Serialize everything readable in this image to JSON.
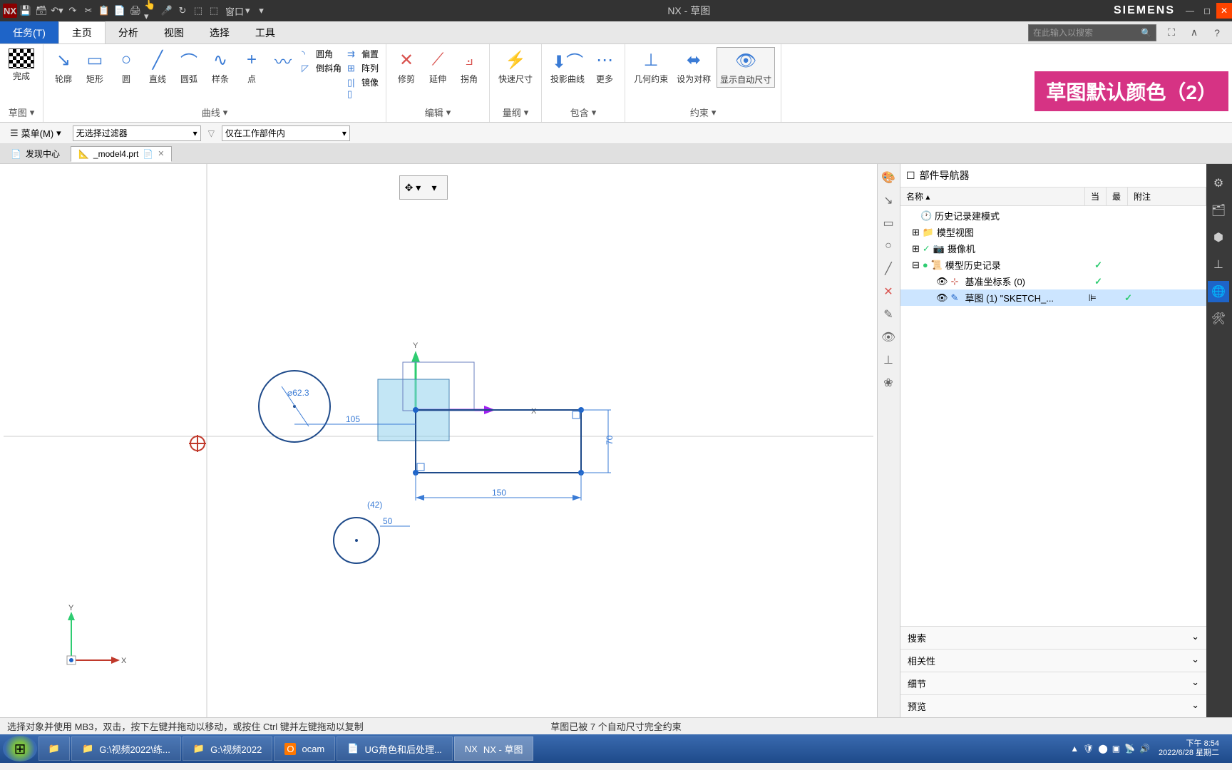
{
  "titlebar": {
    "app_title": "NX - 草图",
    "brand": "SIEMENS",
    "window_menu": "窗口"
  },
  "tabs": {
    "task": "任务(T)",
    "home": "主页",
    "analysis": "分析",
    "view": "视图",
    "select": "选择",
    "tools": "工具"
  },
  "search": {
    "placeholder": "在此输入以搜索"
  },
  "ribbon": {
    "finish": "完成",
    "sketch_group": "草图",
    "profile": "轮廓",
    "rect": "矩形",
    "circle": "圆",
    "line": "直线",
    "arc": "圆弧",
    "spline": "样条",
    "point": "点",
    "fillet": "圆角",
    "chamfer": "倒斜角",
    "offset": "偏置",
    "pattern": "阵列",
    "mirror": "镜像",
    "curve_group": "曲线",
    "trim": "修剪",
    "extend": "延伸",
    "corner": "拐角",
    "edit_group": "编辑",
    "quick_dim": "快速尺寸",
    "dim_group": "量纲",
    "project": "投影曲线",
    "more": "更多",
    "include_group": "包含",
    "geo_constraint": "几何约束",
    "symmetric": "设为对称",
    "show_auto_dim": "显示自动尺寸",
    "constraint_group": "约束"
  },
  "pink_banner": "草图默认颜色（2）",
  "filter": {
    "menu": "菜单(M)",
    "no_filter": "无选择过滤器",
    "workpart": "仅在工作部件内"
  },
  "doctabs": {
    "discover": "发现中心",
    "model": "_model4.prt"
  },
  "sketch_dims": {
    "dia": "62.3",
    "dim105": "105",
    "dim150": "150",
    "dim70": "70",
    "dim50": "50",
    "angle": "(42)"
  },
  "navigator": {
    "title": "部件导航器",
    "col_name": "名称",
    "col_current": "当",
    "col_latest": "最",
    "col_notes": "附注",
    "history_mode": "历史记录建模式",
    "model_view": "模型视图",
    "camera": "摄像机",
    "model_history": "模型历史记录",
    "datum_csys": "基准坐标系 (0)",
    "sketch1": "草图 (1) \"SKETCH_...",
    "search": "搜索",
    "relevance": "相关性",
    "detail": "细节",
    "preview": "预览"
  },
  "status": {
    "hint": "选择对象并使用 MB3，双击，按下左键并拖动以移动，或按住 Ctrl 键并左键拖动以复制",
    "constraint_msg": "草图已被 7 个自动尺寸完全约束"
  },
  "taskbar": {
    "folder1": "G:\\视频2022\\练...",
    "folder2": "G:\\视频2022",
    "ocam": "ocam",
    "ug_doc": "UG角色和后处理...",
    "nx_app": "NX - 草图",
    "time": "下午 8:54",
    "date": "2022/6/28 星期二"
  }
}
